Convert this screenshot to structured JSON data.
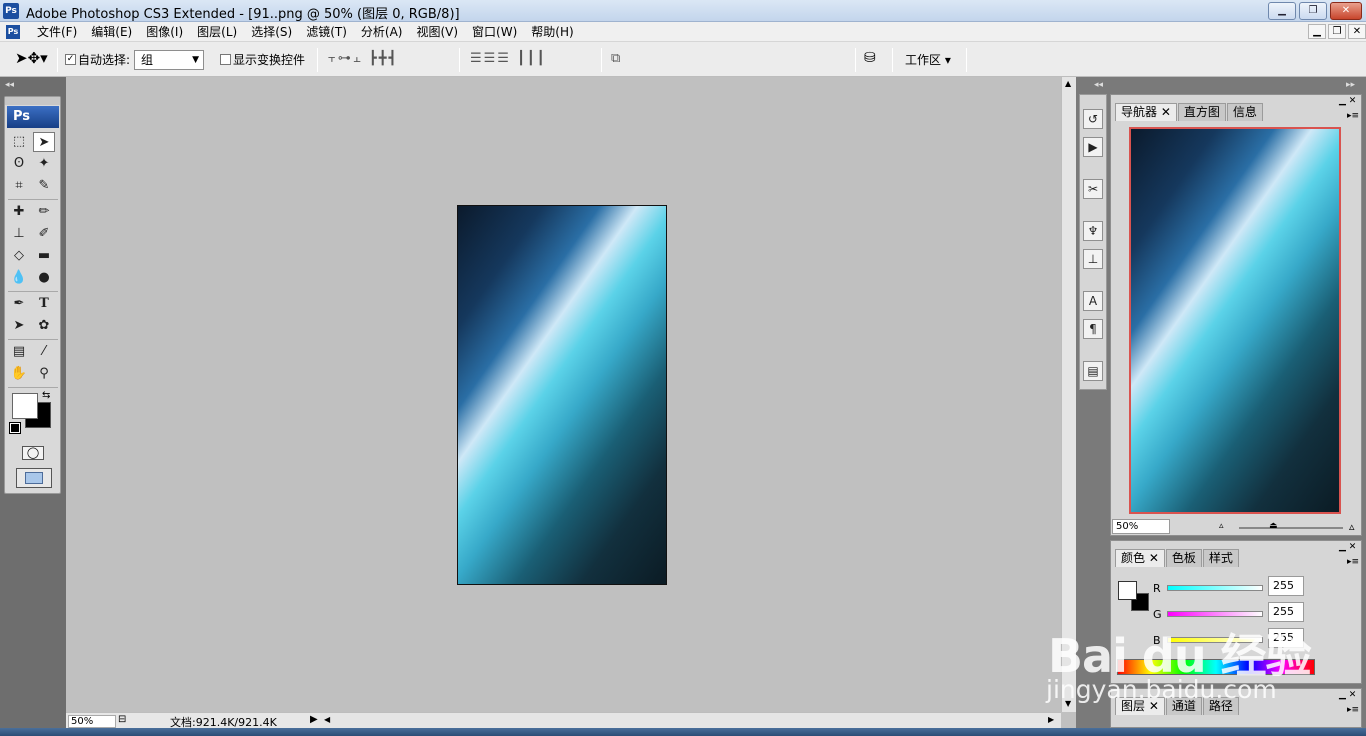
{
  "window": {
    "title": "Adobe Photoshop CS3 Extended - [91..png @ 50% (图层 0, RGB/8)]",
    "app_icon": "Ps",
    "controls": [
      "minimize",
      "restore",
      "close"
    ]
  },
  "menu": {
    "items": [
      "文件(F)",
      "编辑(E)",
      "图像(I)",
      "图层(L)",
      "选择(S)",
      "滤镜(T)",
      "分析(A)",
      "视图(V)",
      "窗口(W)",
      "帮助(H)"
    ]
  },
  "options": {
    "auto_select_label": "自动选择:",
    "auto_select_checked": true,
    "auto_select_value": "组",
    "show_transform_label": "显示变换控件",
    "show_transform_checked": false,
    "workspace_label": "工作区"
  },
  "toolbox": {
    "logo": "Ps"
  },
  "status": {
    "zoom": "50%",
    "doc_size": "文档:921.4K/921.4K"
  },
  "navigator": {
    "tabs": [
      "导航器",
      "直方图",
      "信息"
    ],
    "zoom": "50%",
    "zoom_level": 0.5
  },
  "color": {
    "tabs": [
      "颜色",
      "色板",
      "样式"
    ],
    "channels": [
      {
        "label": "R",
        "value": "255"
      },
      {
        "label": "G",
        "value": "255"
      },
      {
        "label": "B",
        "value": "255"
      }
    ]
  },
  "layers": {
    "tabs": [
      "图层",
      "通道",
      "路径"
    ]
  },
  "watermark": {
    "brand": "Bai du 经验",
    "url": "jingyan.baidu.com"
  },
  "colors": {
    "title_bar": "#c3d5ec",
    "workspace": "#c0c0c0",
    "ps_blue": "#1c4fa0"
  }
}
